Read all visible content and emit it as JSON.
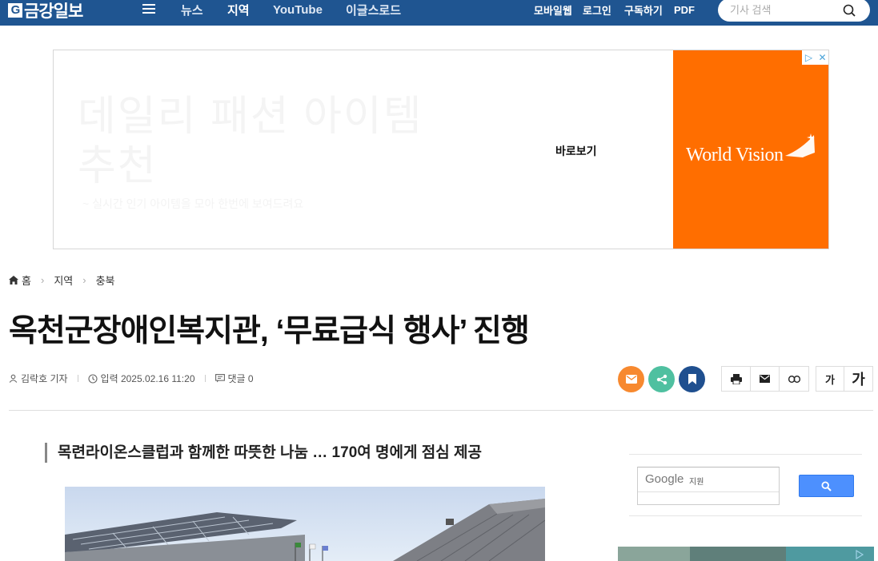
{
  "header": {
    "logo_text": "금강일보",
    "logo_mark": "G",
    "nav": [
      "뉴스",
      "지역",
      "YouTube",
      "이글스로드"
    ],
    "utility": [
      "모바일웹",
      "로그인",
      "구독하기",
      "PDF"
    ],
    "search_placeholder": "기사 검색"
  },
  "ad": {
    "headline": "데일리 패션 아이템 추천",
    "subtext": "~ 실시간 인기 아이템을 모아 한번에 보여드려요",
    "cta": "바로보기",
    "brand": "World Vision",
    "choices_icons": [
      "adchoices-icon",
      "close-icon"
    ]
  },
  "breadcrumb": {
    "home": "홈",
    "items": [
      "지역",
      "충북"
    ]
  },
  "article": {
    "title": "옥천군장애인복지관, ‘무료급식 행사’ 진행",
    "author": "김락호 기자",
    "date": "입력 2025.02.16 11:20",
    "comments": "댓글 0",
    "subtitle": "목련라이온스클럽과 함께한 따뜻한 나눔 … 170여 명에게 점심 제공"
  },
  "share": {
    "colors": {
      "email": "#f7892f",
      "share": "#4fc0a0",
      "bookmark": "#1f4f8f"
    }
  },
  "font_size": {
    "small": "가",
    "large": "가"
  },
  "sidebar": {
    "google_label": "Google",
    "google_sub": "지원"
  },
  "colors": {
    "brand": "#1f5591",
    "ad_orange": "#ff6e00"
  }
}
